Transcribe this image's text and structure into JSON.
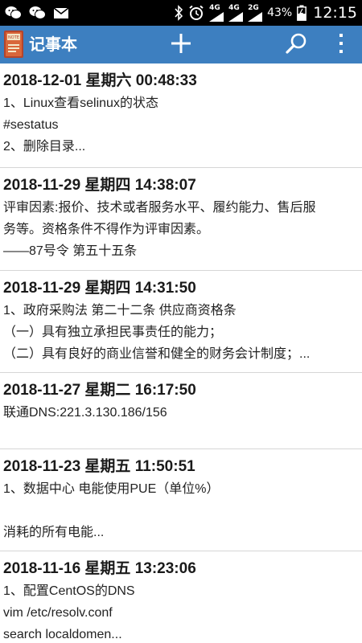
{
  "status_bar": {
    "icons": [
      "wechat-icon",
      "wechat-icon",
      "mail-icon",
      "bluetooth-icon",
      "alarm-icon",
      "signal-4g-icon",
      "signal-4g-icon",
      "signal-2g-icon"
    ],
    "net_label_1": "4G",
    "net_label_2": "4G",
    "net_label_3": "2G",
    "battery": "43%",
    "time": "12:15"
  },
  "action_bar": {
    "title": "记事本",
    "add_icon": "plus-icon",
    "search_icon": "search-icon",
    "menu_icon": "overflow-menu-icon",
    "color": "#3d7fc0"
  },
  "notes": [
    {
      "date": "2018-12-01 星期六 00:48:33",
      "lines": [
        "1、Linux查看selinux的状态",
        "#sestatus",
        "2、删除目录..."
      ]
    },
    {
      "date": "2018-11-29 星期四 14:38:07",
      "lines": [
        "评审因素:报价、技术或者服务水平、履约能力、售后服",
        "务等。资格条件不得作为评审因素。",
        "——87号令 第五十五条"
      ]
    },
    {
      "date": "2018-11-29 星期四 14:31:50",
      "lines": [
        "1、政府采购法 第二十二条 供应商资格条",
        "（一）具有独立承担民事责任的能力；",
        "（二）具有良好的商业信誉和健全的财务会计制度；..."
      ]
    },
    {
      "date": "2018-11-27 星期二 16:17:50",
      "lines": [
        "联通DNS:221.3.130.186/156",
        "",
        ""
      ]
    },
    {
      "date": "2018-11-23 星期五 11:50:51",
      "lines": [
        "1、数据中心 电能使用PUE（单位%）",
        "",
        "消耗的所有电能..."
      ]
    },
    {
      "date": "2018-11-16 星期五 13:23:06",
      "lines": [
        "1、配置CentOS的DNS",
        "vim /etc/resolv.conf",
        "search localdomen..."
      ]
    }
  ]
}
